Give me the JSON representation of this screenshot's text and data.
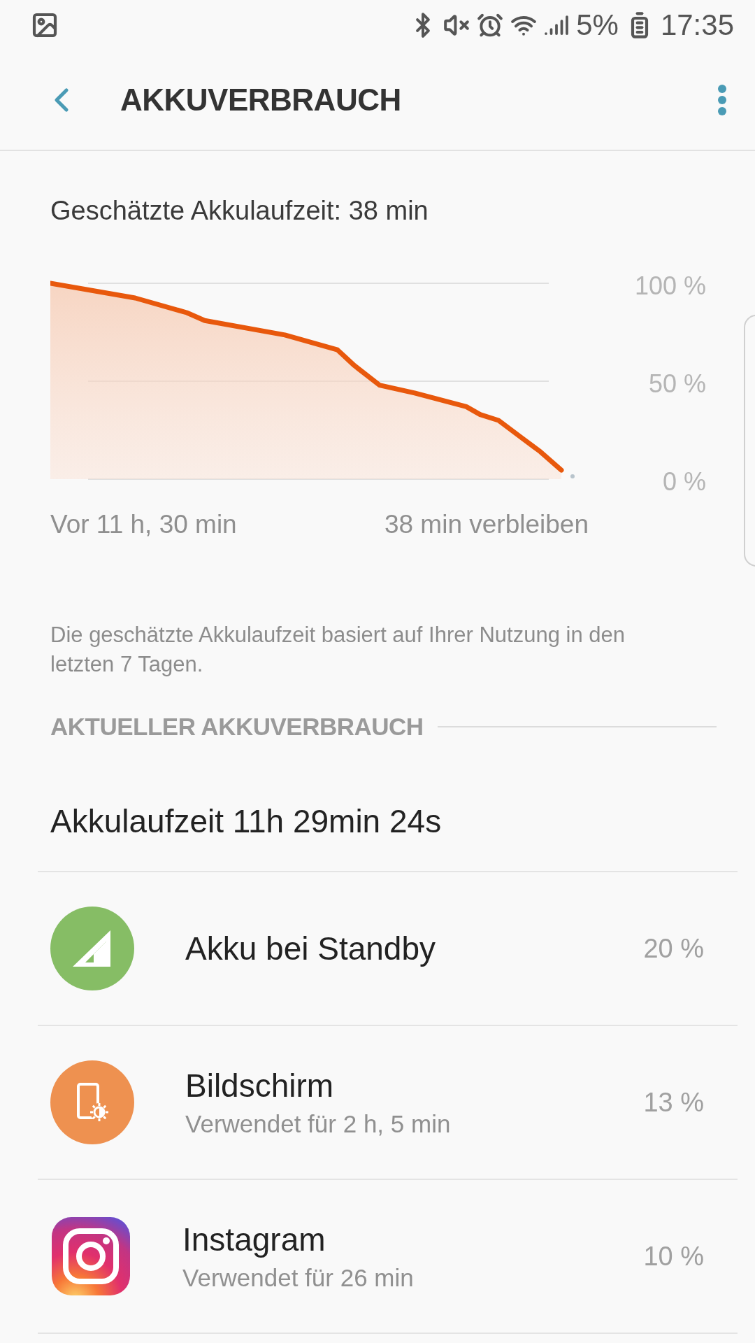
{
  "status_bar": {
    "battery": "5%",
    "time": "17:35"
  },
  "header": {
    "title": "AKKUVERBRAUCH"
  },
  "estimate": "Geschätzte Akkulaufzeit: 38 min",
  "chart_y_labels": [
    "100 %",
    "50 %",
    "0 %"
  ],
  "chart_start_label": "Vor 11 h, 30 min",
  "chart_end_label": "38 min verbleiben",
  "note": "Die geschätzte Akkulaufzeit basiert auf Ihrer Nutzung in den letzten 7 Tagen.",
  "section": {
    "title": "AKTUELLER AKKUVERBRAUCH"
  },
  "runtime": "Akkulaufzeit 11h 29min 24s",
  "items": [
    {
      "kind": "standby",
      "name": "Akku bei Standby",
      "percent": "20 %"
    },
    {
      "kind": "screen",
      "name": "Bildschirm",
      "detail": "Verwendet für 2 h, 5 min",
      "percent": "13 %"
    },
    {
      "kind": "app",
      "name": "Instagram",
      "detail": "Verwendet für 26 min",
      "percent": "10 %"
    }
  ]
}
